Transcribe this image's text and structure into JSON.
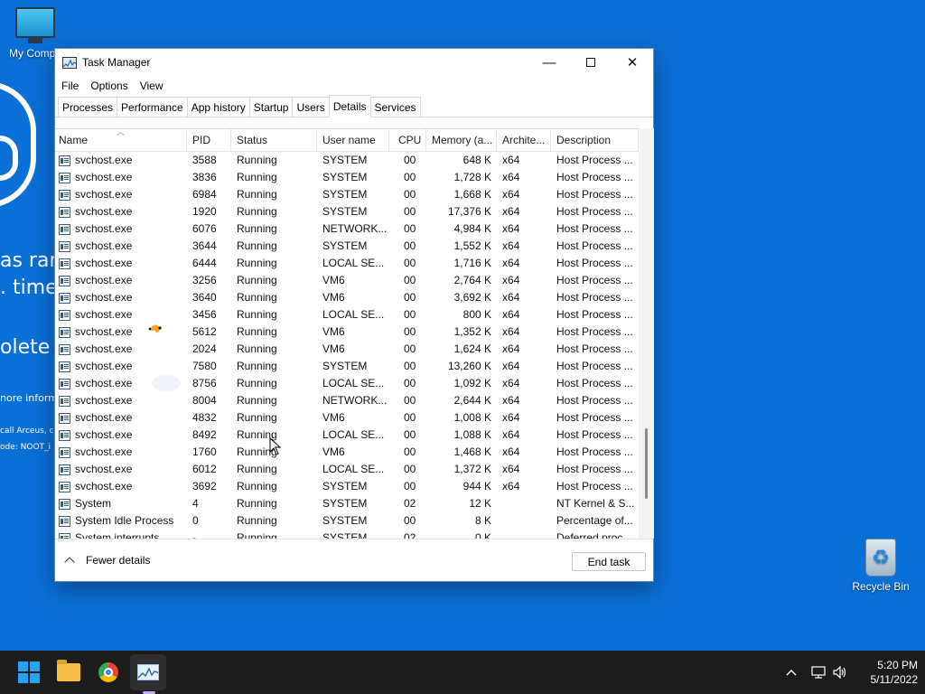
{
  "background": {
    "line1": "as ran",
    "line2": ". time",
    "line3": "olete",
    "line4": "nore inform",
    "line5": "call Arceus, c",
    "line6": "ode: NOOT_i"
  },
  "desktop": {
    "my_computer_label": "My Compu",
    "recycle_bin_label": "Recycle Bin"
  },
  "window": {
    "title": "Task Manager",
    "menu": [
      "File",
      "Options",
      "View"
    ],
    "tabs": [
      "Processes",
      "Performance",
      "App history",
      "Startup",
      "Users",
      "Details",
      "Services"
    ],
    "active_tab": "Details",
    "columns": [
      "Name",
      "PID",
      "Status",
      "User name",
      "CPU",
      "Memory (a...",
      "Archite...",
      "Description"
    ],
    "rows": [
      {
        "name": "svchost.exe",
        "pid": "3588",
        "status": "Running",
        "user": "SYSTEM",
        "cpu": "00",
        "mem": "648 K",
        "arch": "x64",
        "desc": "Host Process ..."
      },
      {
        "name": "svchost.exe",
        "pid": "3836",
        "status": "Running",
        "user": "SYSTEM",
        "cpu": "00",
        "mem": "1,728 K",
        "arch": "x64",
        "desc": "Host Process ..."
      },
      {
        "name": "svchost.exe",
        "pid": "6984",
        "status": "Running",
        "user": "SYSTEM",
        "cpu": "00",
        "mem": "1,668 K",
        "arch": "x64",
        "desc": "Host Process ..."
      },
      {
        "name": "svchost.exe",
        "pid": "1920",
        "status": "Running",
        "user": "SYSTEM",
        "cpu": "00",
        "mem": "17,376 K",
        "arch": "x64",
        "desc": "Host Process ..."
      },
      {
        "name": "svchost.exe",
        "pid": "6076",
        "status": "Running",
        "user": "NETWORK...",
        "cpu": "00",
        "mem": "4,984 K",
        "arch": "x64",
        "desc": "Host Process ..."
      },
      {
        "name": "svchost.exe",
        "pid": "3644",
        "status": "Running",
        "user": "SYSTEM",
        "cpu": "00",
        "mem": "1,552 K",
        "arch": "x64",
        "desc": "Host Process ..."
      },
      {
        "name": "svchost.exe",
        "pid": "6444",
        "status": "Running",
        "user": "LOCAL SE...",
        "cpu": "00",
        "mem": "1,716 K",
        "arch": "x64",
        "desc": "Host Process ..."
      },
      {
        "name": "svchost.exe",
        "pid": "3256",
        "status": "Running",
        "user": "VM6",
        "cpu": "00",
        "mem": "2,764 K",
        "arch": "x64",
        "desc": "Host Process ..."
      },
      {
        "name": "svchost.exe",
        "pid": "3640",
        "status": "Running",
        "user": "VM6",
        "cpu": "00",
        "mem": "3,692 K",
        "arch": "x64",
        "desc": "Host Process ..."
      },
      {
        "name": "svchost.exe",
        "pid": "3456",
        "status": "Running",
        "user": "LOCAL SE...",
        "cpu": "00",
        "mem": "800 K",
        "arch": "x64",
        "desc": "Host Process ..."
      },
      {
        "name": "svchost.exe",
        "pid": "5612",
        "status": "Running",
        "user": "VM6",
        "cpu": "00",
        "mem": "1,352 K",
        "arch": "x64",
        "desc": "Host Process ..."
      },
      {
        "name": "svchost.exe",
        "pid": "2024",
        "status": "Running",
        "user": "VM6",
        "cpu": "00",
        "mem": "1,624 K",
        "arch": "x64",
        "desc": "Host Process ..."
      },
      {
        "name": "svchost.exe",
        "pid": "7580",
        "status": "Running",
        "user": "SYSTEM",
        "cpu": "00",
        "mem": "13,260 K",
        "arch": "x64",
        "desc": "Host Process ..."
      },
      {
        "name": "svchost.exe",
        "pid": "8756",
        "status": "Running",
        "user": "LOCAL SE...",
        "cpu": "00",
        "mem": "1,092 K",
        "arch": "x64",
        "desc": "Host Process ..."
      },
      {
        "name": "svchost.exe",
        "pid": "8004",
        "status": "Running",
        "user": "NETWORK...",
        "cpu": "00",
        "mem": "2,644 K",
        "arch": "x64",
        "desc": "Host Process ..."
      },
      {
        "name": "svchost.exe",
        "pid": "4832",
        "status": "Running",
        "user": "VM6",
        "cpu": "00",
        "mem": "1,008 K",
        "arch": "x64",
        "desc": "Host Process ..."
      },
      {
        "name": "svchost.exe",
        "pid": "8492",
        "status": "Running",
        "user": "LOCAL SE...",
        "cpu": "00",
        "mem": "1,088 K",
        "arch": "x64",
        "desc": "Host Process ..."
      },
      {
        "name": "svchost.exe",
        "pid": "1760",
        "status": "Running",
        "user": "VM6",
        "cpu": "00",
        "mem": "1,468 K",
        "arch": "x64",
        "desc": "Host Process ..."
      },
      {
        "name": "svchost.exe",
        "pid": "6012",
        "status": "Running",
        "user": "LOCAL SE...",
        "cpu": "00",
        "mem": "1,372 K",
        "arch": "x64",
        "desc": "Host Process ..."
      },
      {
        "name": "svchost.exe",
        "pid": "3692",
        "status": "Running",
        "user": "SYSTEM",
        "cpu": "00",
        "mem": "944 K",
        "arch": "x64",
        "desc": "Host Process ..."
      },
      {
        "name": "System",
        "pid": "4",
        "status": "Running",
        "user": "SYSTEM",
        "cpu": "02",
        "mem": "12 K",
        "arch": "",
        "desc": "NT Kernel & S..."
      },
      {
        "name": "System Idle Process",
        "pid": "0",
        "status": "Running",
        "user": "SYSTEM",
        "cpu": "00",
        "mem": "8 K",
        "arch": "",
        "desc": "Percentage of..."
      },
      {
        "name": "System interrupts",
        "pid": "-",
        "status": "Running",
        "user": "SYSTEM",
        "cpu": "02",
        "mem": "0 K",
        "arch": "",
        "desc": "Deferred proc..."
      }
    ],
    "footer": {
      "fewer_details": "Fewer details",
      "end_task": "End task"
    }
  },
  "taskbar": {
    "time": "5:20 PM",
    "date": "5/11/2022"
  },
  "colors": {
    "desktop_bg": "#0a6fd6",
    "taskbar_bg": "#1c1c1c",
    "accent": "#27a2f5"
  },
  "icons": {
    "start": "windows-logo-icon",
    "files": "folder-icon",
    "browser": "chrome-icon",
    "taskmanager": "task-manager-icon",
    "tray_chevron": "chevron-up-icon",
    "network": "network-icon",
    "volume": "volume-icon"
  }
}
